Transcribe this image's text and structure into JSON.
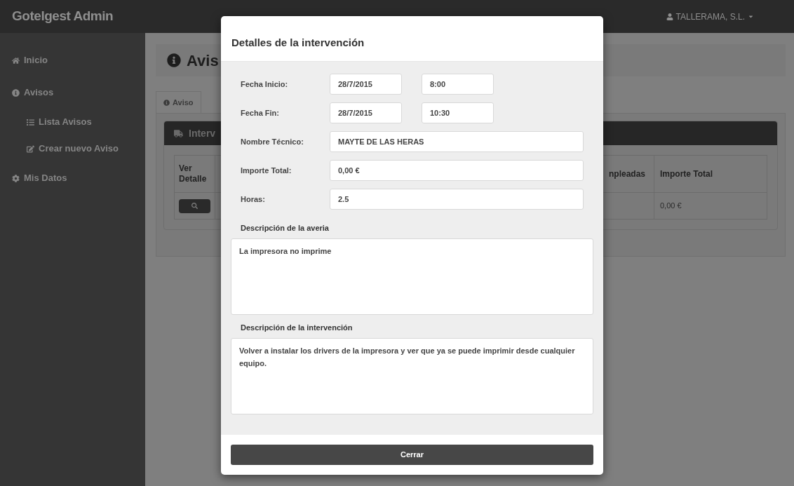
{
  "top_bar": {
    "brand": "Gotelgest Admin",
    "user_menu": "TALLERAMA, S.L."
  },
  "sidebar": {
    "items": [
      {
        "label": "Inicio"
      },
      {
        "label": "Avisos",
        "children": [
          {
            "label": "Lista Avisos"
          },
          {
            "label": "Crear nuevo Aviso"
          }
        ]
      },
      {
        "label": "Mis Datos"
      }
    ]
  },
  "page": {
    "heading": "Avis",
    "tabs": [
      {
        "label": "Aviso",
        "selected": true
      }
    ],
    "panel": {
      "title": "Interv",
      "table": {
        "columns": [
          "Ver Detalle",
          "npleadas",
          "Importe Total"
        ],
        "rows": [
          {
            "importe_total": "0,00 €"
          }
        ]
      }
    }
  },
  "modal": {
    "title": "Detalles de la intervención",
    "fields": [
      {
        "label": "Fecha Inicio:",
        "values": [
          "28/7/2015",
          "8:00"
        ]
      },
      {
        "label": "Fecha Fin:",
        "values": [
          "28/7/2015",
          "10:30"
        ]
      },
      {
        "label": "Nombre Técnico:",
        "values": [
          "MAYTE DE LAS HERAS"
        ]
      },
      {
        "label": "Importe Total:",
        "values": [
          "0,00 €"
        ]
      },
      {
        "label": "Horas:",
        "values": [
          "2.5"
        ]
      }
    ],
    "descriptions": [
      {
        "label": "Descripción de la averia",
        "value": "La impresora no imprime"
      },
      {
        "label": "Descripción de la intervención",
        "value": "Volver a instalar los drivers de la impresora y ver que ya se puede imprimir desde cualquier equipo."
      }
    ],
    "button": "Cerrar"
  }
}
